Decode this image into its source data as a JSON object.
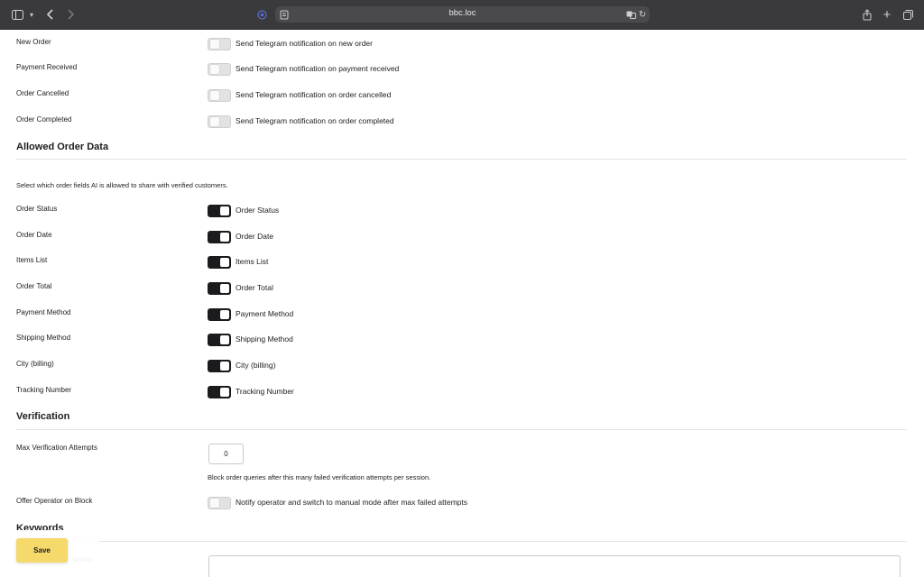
{
  "browser": {
    "url": "bbc.loc"
  },
  "notifications": [
    {
      "label": "New Order",
      "description": "Send Telegram notification on new order",
      "enabled": false
    },
    {
      "label": "Payment Received",
      "description": "Send Telegram notification on payment received",
      "enabled": false
    },
    {
      "label": "Order Cancelled",
      "description": "Send Telegram notification on order cancelled",
      "enabled": false
    },
    {
      "label": "Order Completed",
      "description": "Send Telegram notification on order completed",
      "enabled": false
    }
  ],
  "allowed_order_data": {
    "title": "Allowed Order Data",
    "help": "Select which order fields AI is allowed to share with verified customers.",
    "fields": [
      {
        "label": "Order Status",
        "description": "Order Status",
        "enabled": true
      },
      {
        "label": "Order Date",
        "description": "Order Date",
        "enabled": true
      },
      {
        "label": "Items List",
        "description": "Items List",
        "enabled": true
      },
      {
        "label": "Order Total",
        "description": "Order Total",
        "enabled": true
      },
      {
        "label": "Payment Method",
        "description": "Payment Method",
        "enabled": true
      },
      {
        "label": "Shipping Method",
        "description": "Shipping Method",
        "enabled": true
      },
      {
        "label": "City (billing)",
        "description": "City (billing)",
        "enabled": true
      },
      {
        "label": "Tracking Number",
        "description": "Tracking Number",
        "enabled": true
      }
    ]
  },
  "verification": {
    "title": "Verification",
    "max_attempts_label": "Max Verification Attempts",
    "max_attempts_value": "0",
    "max_attempts_help": "Block order queries after this many failed verification attempts per session.",
    "offer_operator_label": "Offer Operator on Block",
    "offer_operator_desc": "Notify operator and switch to manual mode after max failed attempts",
    "offer_operator_enabled": false
  },
  "keywords": {
    "title": "Keywords",
    "partial_label": "words"
  },
  "save_label": "Save"
}
